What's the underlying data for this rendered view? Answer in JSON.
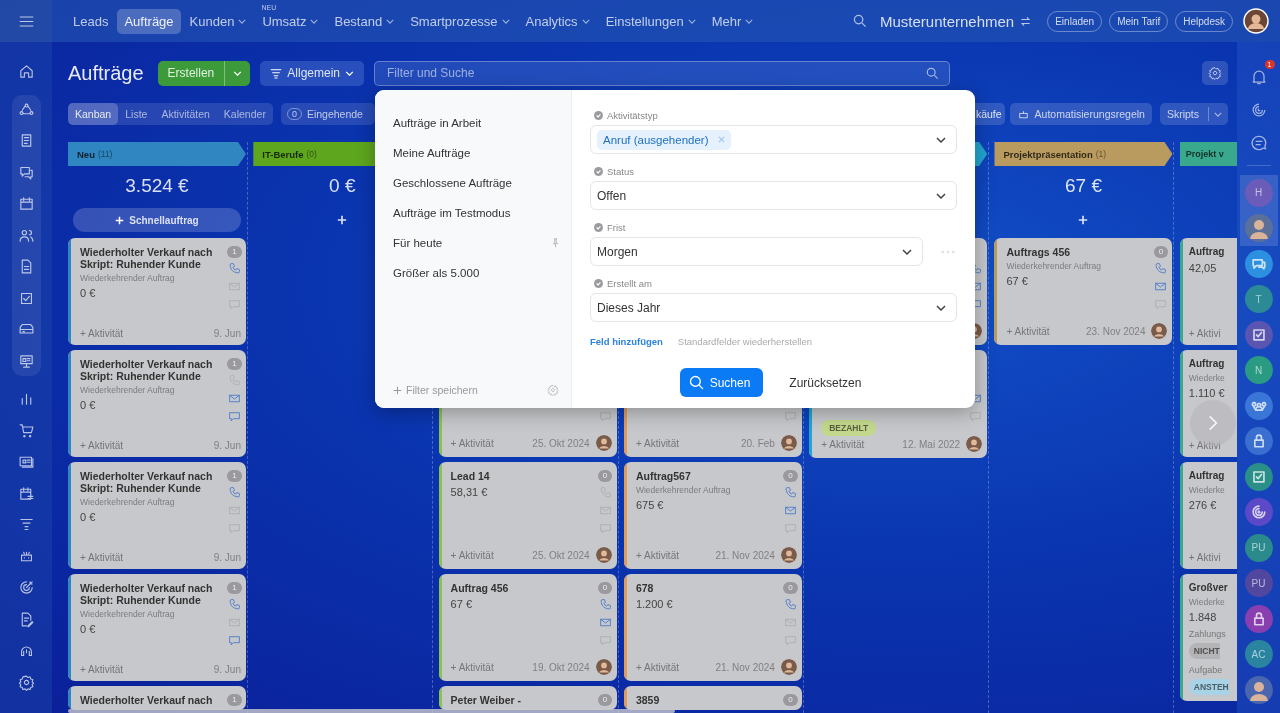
{
  "top_nav": {
    "items": [
      {
        "label": "Leads",
        "selected": false,
        "dropdown": false
      },
      {
        "label": "Aufträge",
        "selected": true,
        "dropdown": false
      },
      {
        "label": "Kunden",
        "selected": false,
        "dropdown": true
      },
      {
        "label": "Umsatz",
        "selected": false,
        "dropdown": true,
        "badge": "NEU"
      },
      {
        "label": "Bestand",
        "selected": false,
        "dropdown": true
      },
      {
        "label": "Smartprozesse",
        "selected": false,
        "dropdown": true
      },
      {
        "label": "Analytics",
        "selected": false,
        "dropdown": true
      },
      {
        "label": "Einstellungen",
        "selected": false,
        "dropdown": true
      },
      {
        "label": "Mehr",
        "selected": false,
        "dropdown": true
      }
    ],
    "company": "Musterunternehmen",
    "buttons": [
      "Einladen",
      "Mein Tarif",
      "Helpdesk"
    ]
  },
  "header": {
    "title": "Aufträge",
    "create_button": "Erstellen",
    "preset": "Allgemein",
    "search": {
      "placeholder": "Filter und Suche"
    }
  },
  "toolbar": {
    "views": [
      {
        "label": "Kanban",
        "selected": true
      },
      {
        "label": "Liste",
        "selected": false
      },
      {
        "label": "Aktivitäten",
        "selected": false
      },
      {
        "label": "Kalender",
        "selected": false
      }
    ],
    "incoming": {
      "count": "0",
      "label": "Eingehende"
    },
    "purchases": "käufe",
    "automation": "Automatisierungsregeln",
    "scripts": "Skripts"
  },
  "columns": [
    {
      "kind": "open",
      "title": "Neu",
      "count": "(11)",
      "color": "#2f86c0",
      "total": "3.524 €",
      "quick_add": "Schnellauftrag",
      "cards": [
        {
          "kind": "full",
          "title": "Wiederholter Verkauf nach Skript: Ruhender Kunde",
          "subtitle": "Wiederkehrender Auftrag",
          "amount": "0 €",
          "counter": "1",
          "call": true,
          "mail": false,
          "chat": false,
          "activity": "+ Aktivität",
          "date": "9. Jun",
          "avatar": false
        },
        {
          "kind": "full",
          "title": "Wiederholter Verkauf nach Skript: Ruhender Kunde",
          "subtitle": "Wiederkehrender Auftrag",
          "amount": "0 €",
          "counter": "1",
          "call": false,
          "mail": true,
          "chat": true,
          "activity": "+ Aktivität",
          "date": "9. Jun",
          "avatar": false
        },
        {
          "kind": "full",
          "title": "Wiederholter Verkauf nach Skript: Ruhender Kunde",
          "subtitle": "Wiederkehrender Auftrag",
          "amount": "0 €",
          "counter": "1",
          "call": true,
          "mail": false,
          "chat": false,
          "activity": "+ Aktivität",
          "date": "9. Jun",
          "avatar": false
        },
        {
          "kind": "full",
          "title": "Wiederholter Verkauf nach Skript: Ruhender Kunde",
          "subtitle": "Wiederkehrender Auftrag",
          "amount": "0 €",
          "counter": "1",
          "call": true,
          "mail": false,
          "chat": true,
          "activity": "+ Aktivität",
          "date": "9. Jun",
          "avatar": false
        },
        {
          "kind": "cut",
          "title": "Wiederholter Verkauf nach",
          "counter": "1"
        }
      ]
    },
    {
      "kind": "open",
      "title": "IT-Berufe",
      "count": "(0)",
      "color": "#5ea61e",
      "total": "0 €",
      "add": true
    },
    {
      "kind": "covered",
      "color": "#8cc152",
      "cards": [
        {
          "kind": "low-tail",
          "chat": false,
          "activity": "+ Aktivität",
          "date": "25. Okt 2024",
          "avatar": true
        },
        {
          "kind": "full",
          "title": "Lead 14",
          "amount": "58,31 €",
          "counter": "0",
          "call": false,
          "mail": false,
          "chat": false,
          "activity": "+ Aktivität",
          "date": "25. Okt 2024",
          "avatar": true
        },
        {
          "kind": "full",
          "title": "Auftrag 456",
          "amount": "67 €",
          "counter": "0",
          "call": true,
          "mail": true,
          "chat": false,
          "activity": "+ Aktivität",
          "date": "19. Okt 2024",
          "avatar": true
        },
        {
          "kind": "cut",
          "title": "Peter Weiber -",
          "counter": "0"
        }
      ]
    },
    {
      "kind": "covered",
      "color": "#e09a5a",
      "cards": [
        {
          "kind": "low-tail",
          "chat": false,
          "activity": "+ Aktivität",
          "date": "20. Feb",
          "avatar": true
        },
        {
          "kind": "full",
          "title": "Auftrag567",
          "subtitle": "Wiederkehrender Auftrag",
          "amount": "675 €",
          "counter": "0",
          "call": true,
          "mail": true,
          "chat": false,
          "activity": "+ Aktivität",
          "date": "21. Nov 2024",
          "avatar": true
        },
        {
          "kind": "full",
          "title": "678",
          "amount": "1.200 €",
          "counter": "0",
          "call": true,
          "mail": false,
          "chat": false,
          "activity": "+ Aktivität",
          "date": "21. Nov 2024",
          "avatar": true
        },
        {
          "kind": "cut",
          "title": "3859",
          "counter": "0"
        }
      ]
    },
    {
      "kind": "open",
      "color": "#22a5cf",
      "cards": [
        {
          "kind": "tail",
          "call": true,
          "mail": true,
          "chat": true,
          "avatar": true
        },
        {
          "kind": "tail",
          "mail": true,
          "chat": false,
          "badges": [
            {
              "text": "BEZAHLT",
              "color": "#c3d88c"
            }
          ],
          "activity": "+ Aktivität",
          "date": "12. Mai 2022",
          "avatar": true
        }
      ]
    },
    {
      "kind": "open",
      "title": "Projektpräsentation",
      "count": "(1)",
      "color": "#b99b60",
      "total": "67 €",
      "add": true,
      "cards": [
        {
          "kind": "full",
          "title": "Auftrags 456",
          "subtitle": "Wiederkehrender Auftrag",
          "amount": "67 €",
          "counter": "0",
          "call": true,
          "mail": true,
          "chat": false,
          "activity": "+ Aktivität",
          "date": "23. Nov 2024",
          "avatar": true
        }
      ]
    },
    {
      "kind": "open",
      "title": "Projekt v",
      "color": "#3aa88c",
      "cards": [
        {
          "kind": "full",
          "title": "Auftrag",
          "amount": "42,05",
          "activity": "+ Aktivi"
        },
        {
          "kind": "full",
          "title": "Auftrag",
          "subtitle": "Wiederke",
          "amount": "1.110 €",
          "activity": "+ Aktivi"
        },
        {
          "kind": "full",
          "title": "Auftrag",
          "subtitle": "Wiederke",
          "amount": "276 €",
          "activity": "+ Aktivi"
        },
        {
          "kind": "full",
          "title": "Großver",
          "subtitle": "Wiederke",
          "amount": "1.848",
          "badges": [
            {
              "label": "Zahlungs",
              "text": "NICHT",
              "color": "#b4b4b6"
            },
            {
              "label": "Aufgabe",
              "text": "ANSTEH",
              "color": "#a8d3e6"
            }
          ]
        }
      ]
    }
  ],
  "filter_popup": {
    "presets": [
      {
        "label": "Aufträge in Arbeit",
        "pinned": false
      },
      {
        "label": "Meine Aufträge",
        "pinned": false
      },
      {
        "label": "Geschlossene Aufträge",
        "pinned": false
      },
      {
        "label": "Aufträge im Testmodus",
        "pinned": false
      },
      {
        "label": "Für heute",
        "pinned": true
      },
      {
        "label": "Größer als 5.000",
        "pinned": false
      }
    ],
    "save_filter": "Filter speichern",
    "fields": [
      {
        "label": "Aktivitätstyp",
        "kind": "tags",
        "tags": [
          "Anruf (ausgehender)"
        ],
        "more": false
      },
      {
        "label": "Status",
        "kind": "select",
        "value": "Offen",
        "more": false
      },
      {
        "label": "Frist",
        "kind": "select",
        "value": "Morgen",
        "more": true
      },
      {
        "label": "Erstellt am",
        "kind": "select",
        "value": "Dieses Jahr",
        "more": false
      }
    ],
    "add_field": "Feld hinzufügen",
    "restore": "Standardfelder wiederherstellen",
    "search_button": "Suchen",
    "reset_button": "Zurücksetzen"
  },
  "right_sidebar": {
    "tools": [
      {
        "kind": "bell",
        "badge": "1"
      },
      {
        "kind": "swirl"
      },
      {
        "kind": "chat"
      }
    ],
    "chats": [
      {
        "kind": "letter",
        "text": "H",
        "color": "#6a5cb8",
        "active": true
      },
      {
        "kind": "photo",
        "color": "#5a6f9a",
        "active": true
      },
      {
        "kind": "message",
        "color": "#2d8fe0",
        "active": false
      },
      {
        "kind": "letter",
        "text": "T",
        "color": "#2b8a95",
        "active": false
      },
      {
        "kind": "check",
        "color": "#5a55b0",
        "active": false
      },
      {
        "kind": "letter",
        "text": "N",
        "color": "#2a9a82",
        "active": false
      },
      {
        "kind": "team",
        "color": "#3a76d8",
        "active": false
      },
      {
        "kind": "lock",
        "color": "#3a6fd0",
        "active": false
      },
      {
        "kind": "check",
        "color": "#2a8f88",
        "active": false
      },
      {
        "kind": "swirl",
        "color": "#5b49c8",
        "active": false
      },
      {
        "kind": "letter",
        "text": "PU",
        "color": "#2a8a8c",
        "active": false
      },
      {
        "kind": "letter",
        "text": "PU",
        "color": "#51479e",
        "active": false
      },
      {
        "kind": "lock",
        "color": "#8a3fb0",
        "active": false
      },
      {
        "kind": "letter",
        "text": "AC",
        "color": "#2a84a0",
        "active": false
      },
      {
        "kind": "photo",
        "color": "#4a66b0",
        "active": false
      }
    ]
  }
}
